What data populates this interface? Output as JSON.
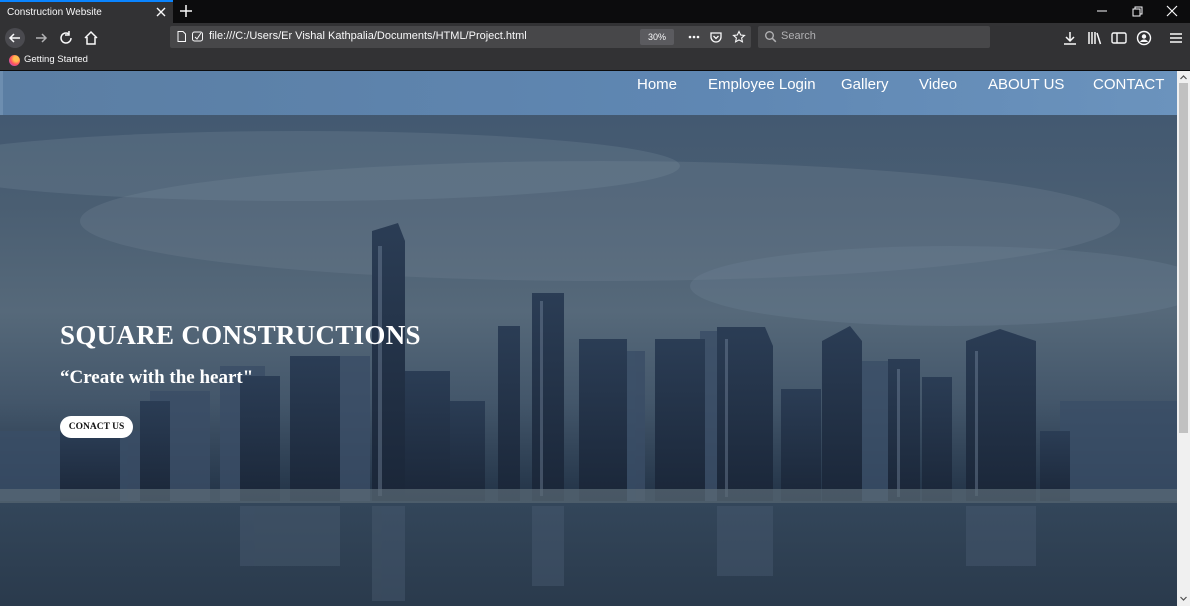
{
  "browser": {
    "tab_title": "Construction Website",
    "url": "file:///C:/Users/Er Vishal Kathpalia/Documents/HTML/Project.html",
    "zoom": "30%",
    "search_placeholder": "Search",
    "bookmark": "Getting Started"
  },
  "site": {
    "nav": [
      "Home",
      "Employee Login",
      "Gallery",
      "Video",
      "ABOUT US",
      "CONTACT"
    ],
    "hero_title": "SQUARE CONSTRUCTIONS",
    "hero_subtitle": "“Create with the heart\"",
    "cta_label": "CONACT US"
  },
  "colors": {
    "accent_tab": "#0a84ff",
    "header": "#5f87b3",
    "chrome": "#323234"
  }
}
